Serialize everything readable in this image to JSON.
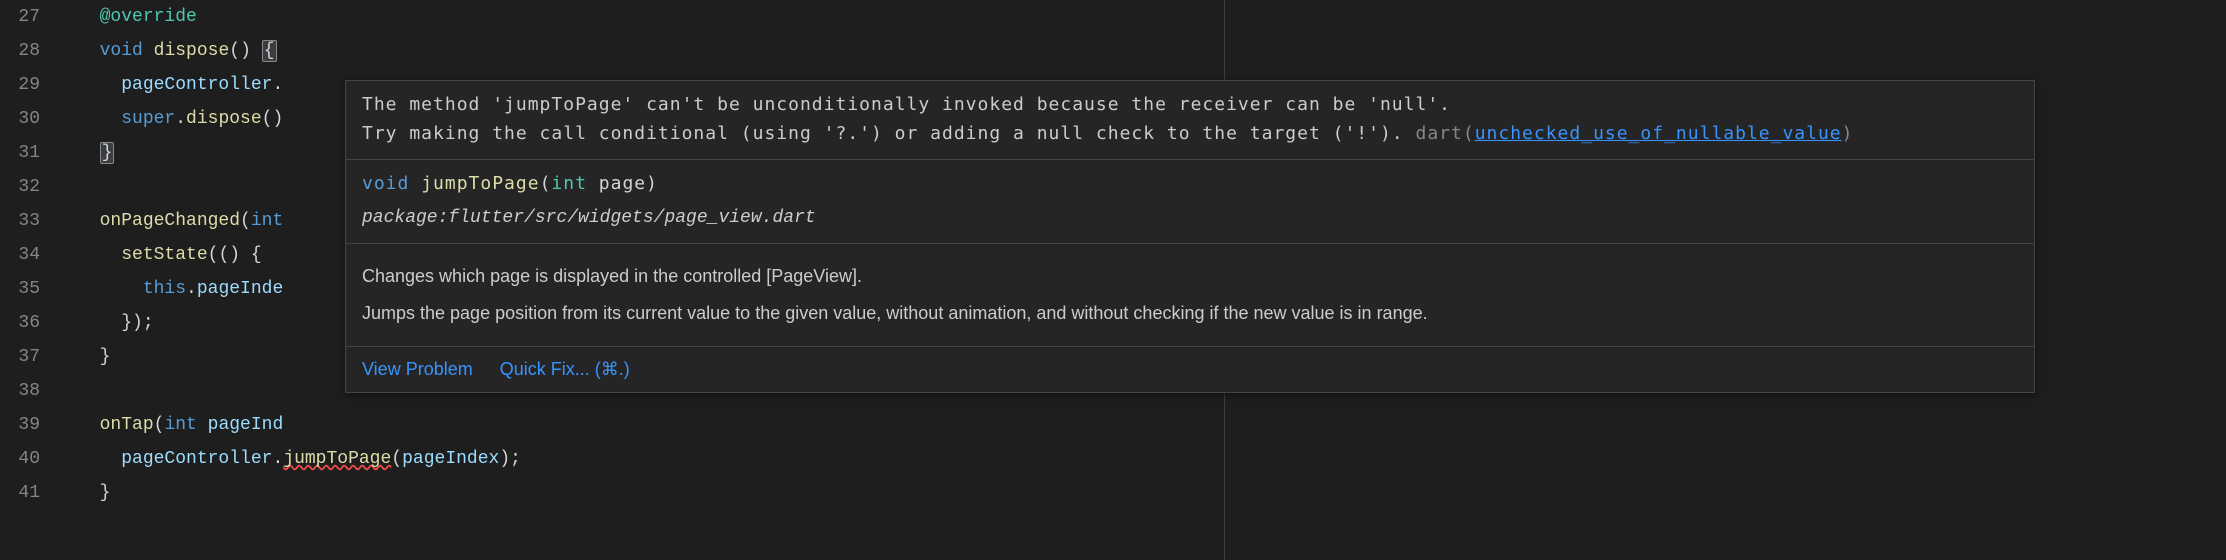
{
  "lines": {
    "start": 27,
    "end": 41
  },
  "code": {
    "l27_override": "@override",
    "l28_void": "void",
    "l28_dispose": "dispose",
    "l28_parens": "()",
    "l28_brace": "{",
    "l29_pageController": "pageController",
    "l29_dot": ".",
    "l30_super": "super",
    "l30_dot": ".",
    "l30_dispose": "dispose",
    "l30_end": "()",
    "l31_brace": "}",
    "l33_onPageChanged": "onPageChanged",
    "l33_int": "int",
    "l34_setState": "setState",
    "l34_arrow": "(() {",
    "l35_this": "this",
    "l35_dot": ".",
    "l35_pageInde": "pageInde",
    "l36_close": "});",
    "l37_brace": "}",
    "l39_onTap": "onTap",
    "l39_int": "int",
    "l39_pageInd": "pageInd",
    "l40_pageController": "pageController",
    "l40_dot": ".",
    "l40_jumpToPage": "jumpToPage",
    "l40_pageIndex": "pageIndex",
    "l40_end": ");",
    "l41_brace": "}"
  },
  "hover": {
    "error_line1": "The method 'jumpToPage' can't be unconditionally invoked because the receiver can be 'null'.",
    "error_line2a": "Try making the call conditional (using '?.') or adding a null check to the target ('!'). ",
    "error_source": "dart",
    "error_link": "unchecked_use_of_nullable_value",
    "sig_void": "void",
    "sig_fn": "jumpToPage",
    "sig_int": "int",
    "sig_param": "page",
    "package": "package:flutter/src/widgets/page_view.dart",
    "doc1": "Changes which page is displayed in the controlled [PageView].",
    "doc2": "Jumps the page position from its current value to the given value, without animation, and without checking if the new value is in range.",
    "action_view": "View Problem",
    "action_quickfix": "Quick Fix... (⌘.)"
  }
}
